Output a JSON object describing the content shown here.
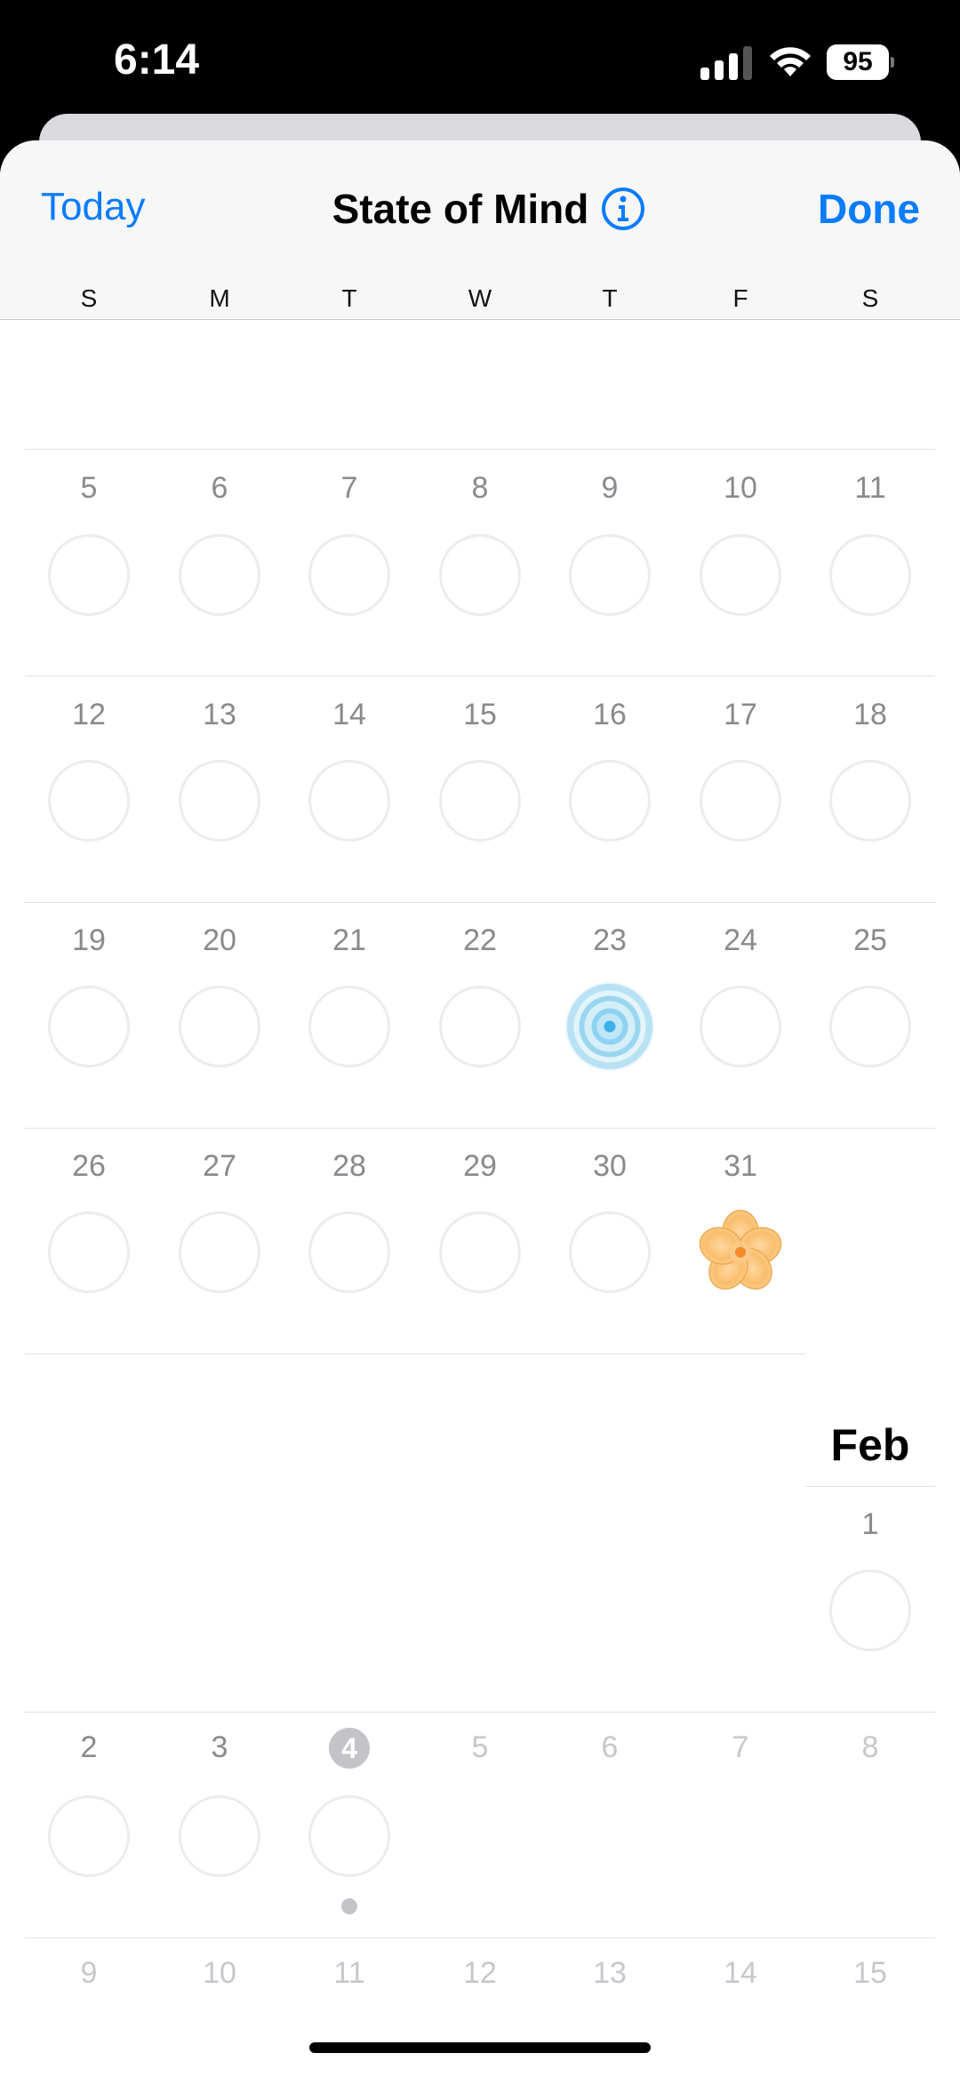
{
  "status_bar": {
    "time": "6:14",
    "battery": "95",
    "icons": [
      "cellular-signal-icon",
      "wifi-icon",
      "battery-icon"
    ]
  },
  "header": {
    "today_label": "Today",
    "title": "State of Mind",
    "done_label": "Done",
    "info_icon": "info-circle-icon"
  },
  "colors": {
    "accent": "#0a7cff",
    "ring": "#ececef",
    "muted_text": "#8a8a8e",
    "future_text": "#c7c7cc"
  },
  "weekdays": [
    "S",
    "M",
    "T",
    "W",
    "T",
    "F",
    "S"
  ],
  "january_weeks": [
    [
      "5",
      "6",
      "7",
      "8",
      "9",
      "10",
      "11"
    ],
    [
      "12",
      "13",
      "14",
      "15",
      "16",
      "17",
      "18"
    ],
    [
      "19",
      "20",
      "21",
      "22",
      "23",
      "24",
      "25"
    ],
    [
      "26",
      "27",
      "28",
      "29",
      "30",
      "31"
    ]
  ],
  "mood_entries": [
    {
      "day": "23",
      "icon": "mood-swirl-icon",
      "color": "#8ed2ef"
    },
    {
      "day": "31",
      "icon": "mood-flower-icon",
      "color": "#f6b25a"
    }
  ],
  "february": {
    "label": "Feb",
    "week1": [
      "1"
    ],
    "week2": [
      "2",
      "3",
      "4",
      "5",
      "6",
      "7",
      "8"
    ],
    "week3": [
      "9",
      "10",
      "11",
      "12",
      "13",
      "14",
      "15"
    ],
    "today": "4"
  }
}
